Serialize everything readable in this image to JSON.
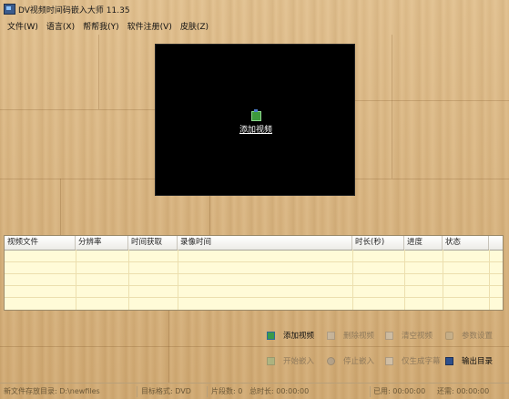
{
  "window": {
    "title": "DV视频时间码嵌入大师  11.35"
  },
  "menu": [
    "文件(W)",
    "语言(X)",
    "帮帮我(Y)",
    "软件注册(V)",
    "皮肤(Z)"
  ],
  "preview": {
    "add_video_label": "添加视频",
    "icon": "film-icon",
    "background": "#000000"
  },
  "table": {
    "columns": [
      "视频文件",
      "分辨率",
      "时间获取",
      "录像时间",
      "时长(秒)",
      "进度",
      "状态"
    ],
    "rows": []
  },
  "actions": {
    "add_video": {
      "label": "添加视频",
      "enabled": true,
      "icon": "add-video-icon"
    },
    "delete_video": {
      "label": "删除视频",
      "enabled": false,
      "icon": "delete-video-icon"
    },
    "clear_video": {
      "label": "清空视频",
      "enabled": false,
      "icon": "clear-video-icon"
    },
    "param_settings": {
      "label": "参数设置",
      "enabled": false,
      "icon": "wrench-icon"
    },
    "start_embed": {
      "label": "开始嵌入",
      "enabled": false,
      "icon": "start-icon"
    },
    "stop_embed": {
      "label": "停止嵌入",
      "enabled": false,
      "icon": "stop-icon"
    },
    "subtitles_only": {
      "label": "仅生成字幕",
      "enabled": false,
      "icon": "subtitle-icon"
    },
    "output_dir": {
      "label": "输出目录",
      "enabled": true,
      "icon": "folder-pen-icon"
    }
  },
  "status": {
    "output_dir": "新文件存放目录: D:\\newfiles",
    "target_format": "目标格式: DVD",
    "clip_count": "片段数: 0",
    "total_duration": "总时长: 00:00:00",
    "used": "已用: 00:00:00",
    "remaining": "还需: 00:00:00"
  },
  "colors": {
    "wood": "#d6b07a",
    "table_bg": "#fffbd8",
    "preview_bg": "#000000"
  }
}
